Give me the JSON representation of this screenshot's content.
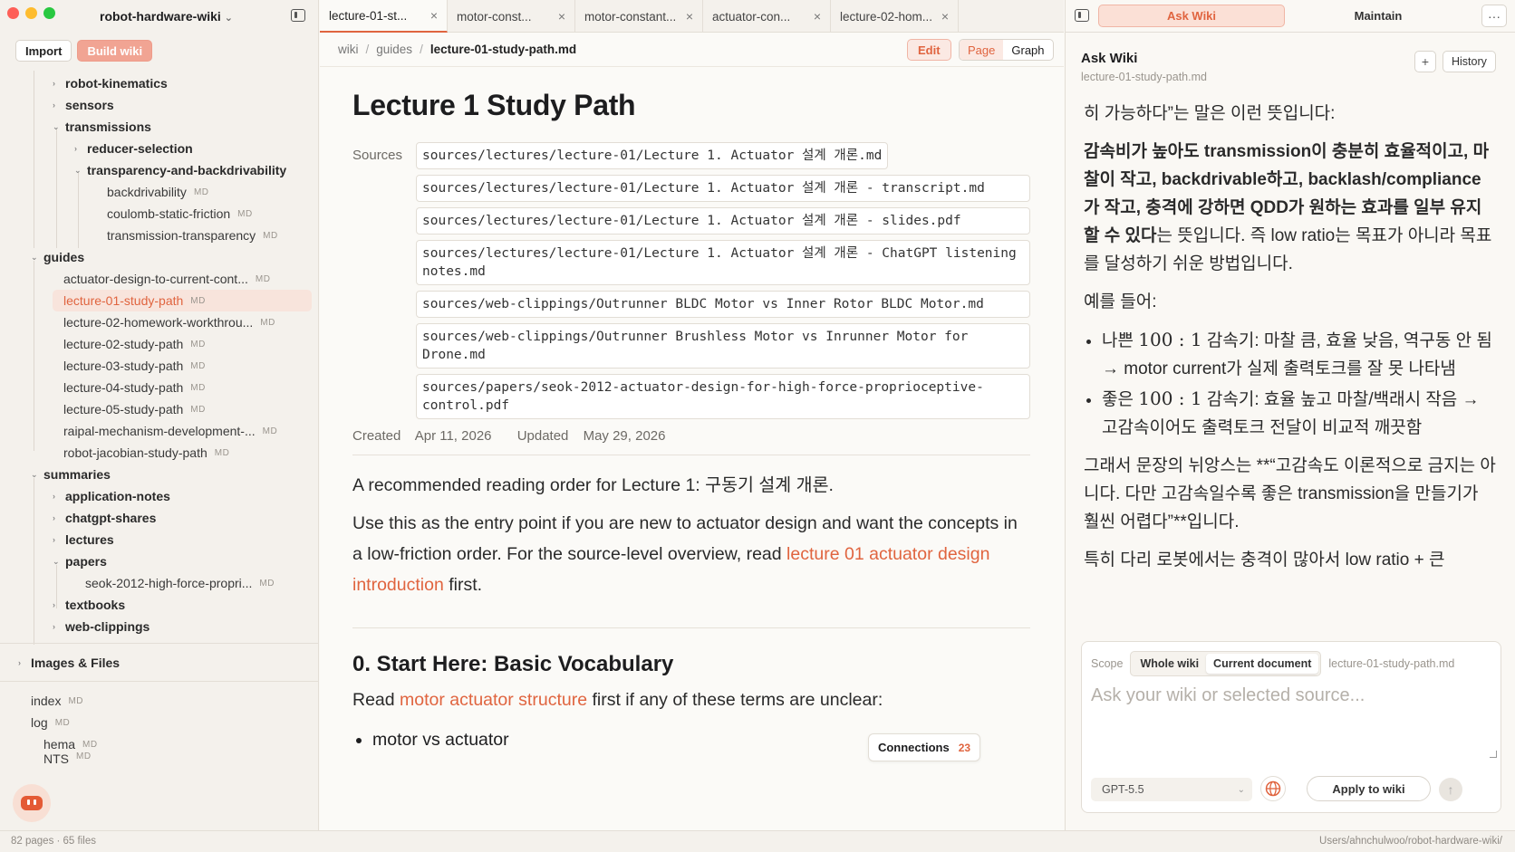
{
  "sidebar": {
    "app_title": "robot-hardware-wiki",
    "import_label": "Import",
    "build_label": "Build wiki",
    "tree": [
      {
        "label": "robot-kinematics",
        "type": "folder"
      },
      {
        "label": "sensors",
        "type": "folder"
      },
      {
        "label": "transmissions",
        "type": "folder"
      },
      {
        "label": "reducer-selection",
        "type": "folder"
      },
      {
        "label": "transparency-and-backdrivability",
        "type": "folder"
      },
      {
        "label": "backdrivability",
        "badge": "MD"
      },
      {
        "label": "coulomb-static-friction",
        "badge": "MD"
      },
      {
        "label": "transmission-transparency",
        "badge": "MD"
      },
      {
        "label": "guides",
        "type": "folder"
      },
      {
        "label": "actuator-design-to-current-cont...",
        "badge": "MD"
      },
      {
        "label": "lecture-01-study-path",
        "badge": "MD"
      },
      {
        "label": "lecture-02-homework-workthrou...",
        "badge": "MD"
      },
      {
        "label": "lecture-02-study-path",
        "badge": "MD"
      },
      {
        "label": "lecture-03-study-path",
        "badge": "MD"
      },
      {
        "label": "lecture-04-study-path",
        "badge": "MD"
      },
      {
        "label": "lecture-05-study-path",
        "badge": "MD"
      },
      {
        "label": "raipal-mechanism-development-...",
        "badge": "MD"
      },
      {
        "label": "robot-jacobian-study-path",
        "badge": "MD"
      },
      {
        "label": "summaries",
        "type": "folder"
      },
      {
        "label": "application-notes",
        "type": "folder"
      },
      {
        "label": "chatgpt-shares",
        "type": "folder"
      },
      {
        "label": "lectures",
        "type": "folder"
      },
      {
        "label": "papers",
        "type": "folder"
      },
      {
        "label": "seok-2012-high-force-propri...",
        "badge": "MD"
      },
      {
        "label": "textbooks",
        "type": "folder"
      },
      {
        "label": "web-clippings",
        "type": "folder"
      },
      {
        "label": "Images & Files",
        "type": "folder"
      },
      {
        "label": "index",
        "badge": "MD"
      },
      {
        "label": "log",
        "badge": "MD"
      },
      {
        "label": "hema",
        "badge": "MD"
      },
      {
        "label": "NTS",
        "badge": "MD"
      }
    ]
  },
  "status": {
    "left": "82 pages · 65 files",
    "right": "Users/ahnchulwoo/robot-hardware-wiki/"
  },
  "tabs": [
    {
      "label": "lecture-01-st..."
    },
    {
      "label": "motor-const..."
    },
    {
      "label": "motor-constant..."
    },
    {
      "label": "actuator-con..."
    },
    {
      "label": "lecture-02-hom..."
    }
  ],
  "breadcrumb": {
    "a": "wiki",
    "b": "guides",
    "current": "lecture-01-study-path.md"
  },
  "toolbar": {
    "edit": "Edit",
    "page": "Page",
    "graph": "Graph"
  },
  "doc": {
    "title": "Lecture 1 Study Path",
    "sources_label": "Sources",
    "sources": [
      "sources/lectures/lecture-01/Lecture 1. Actuator 설계 개론.md",
      "sources/lectures/lecture-01/Lecture 1. Actuator 설계 개론 - transcript.md",
      "sources/lectures/lecture-01/Lecture 1. Actuator 설계 개론 - slides.pdf",
      "sources/lectures/lecture-01/Lecture 1. Actuator 설계 개론 - ChatGPT listening notes.md",
      "sources/web-clippings/Outrunner BLDC Motor vs Inner Rotor BLDC Motor.md",
      "sources/web-clippings/Outrunner Brushless Motor vs Inrunner Motor for Drone.md",
      "sources/papers/seok-2012-actuator-design-for-high-force-proprioceptive-control.pdf"
    ],
    "created_label": "Created",
    "created": "Apr 11, 2026",
    "updated_label": "Updated",
    "updated": "May 29, 2026",
    "intro": "A recommended reading order for Lecture 1: 구동기 설계 개론.",
    "para2_pre": "Use this as the entry point if you are new to actuator design and want the concepts in a low-friction order. For the source-level overview, read ",
    "para2_link": "lecture 01 actuator design introduction",
    "para2_post": " first.",
    "h2": "0. Start Here: Basic Vocabulary",
    "para3_pre": "Read ",
    "para3_link": "motor actuator structure",
    "para3_post": " first if any of these terms are unclear:",
    "bullet1": "motor vs actuator"
  },
  "connections": {
    "label": "Connections",
    "count": "23"
  },
  "right": {
    "tab_ask": "Ask Wiki",
    "tab_maintain": "Maintain",
    "more": "···",
    "title": "Ask Wiki",
    "subtitle": "lecture-01-study-path.md",
    "plus": "+",
    "history": "History",
    "p1": "히 가능하다”는 말은 이런 뜻입니다:",
    "p2_bold": "감속비가 높아도 transmission이 충분히 효율적이고, 마찰이 작고, backdrivable하고, backlash/compliance가 작고, 충격에 강하면 QDD가 원하는 효과를 일부 유지할 수 있다",
    "p2_rest": "는 뜻입니다. 즉 low ratio는 목표가 아니라 목표를 달성하기 쉬운 방법입니다.",
    "p3": "예를 들어:",
    "li1_pre": "나쁜 ",
    "li1_ratio": "100 : 1",
    "li1_post": " 감속기: 마찰 큼, 효율 낮음, 역구동 안 됨 → motor current가 실제 출력토크를 잘 못 나타냄",
    "li2_pre": "좋은 ",
    "li2_ratio": "100 : 1",
    "li2_post": " 감속기: 효율 높고 마찰/백래시 작음 → 고감속이어도 출력토크 전달이 비교적 깨끗함",
    "p4": "그래서 문장의 뉘앙스는 **“고감속도 이론적으로 금지는 아니다. 다만 고감속일수록 좋은 transmission을 만들기가 훨씬 어렵다”**입니다.",
    "p5": "특히 다리 로봇에서는 충격이 많아서 low ratio + 큰",
    "scope_label": "Scope",
    "scope_whole": "Whole wiki",
    "scope_current": "Current document",
    "scope_file": "lecture-01-study-path.md",
    "placeholder": "Ask your wiki or selected source...",
    "model": "GPT-5.5",
    "apply": "Apply to wiki"
  },
  "colors": {
    "accent": "#e0643f",
    "accent_soft": "#fbe0d6"
  }
}
